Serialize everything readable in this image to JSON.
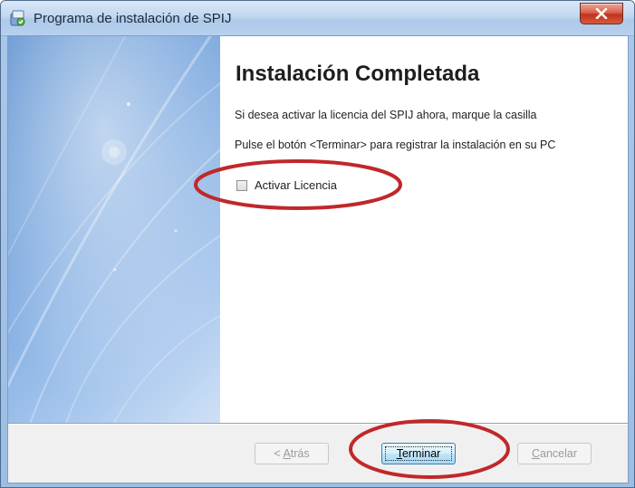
{
  "window": {
    "title": "Programa de instalación de SPIJ",
    "icon": "installer-icon",
    "close_icon": "close-icon"
  },
  "content": {
    "heading": "Instalación Completada",
    "paragraph1": "Si desea activar la licencia del SPIJ ahora, marque la casilla",
    "paragraph2": "Pulse el botón <Terminar> para registrar la instalación en su PC",
    "checkbox": {
      "label": "Activar Licencia",
      "checked": false
    }
  },
  "footer": {
    "back": {
      "prefix": "< ",
      "mnemonic": "A",
      "rest": "trás",
      "enabled": false
    },
    "finish": {
      "mnemonic": "T",
      "rest": "erminar",
      "enabled": true,
      "default": true
    },
    "cancel": {
      "mnemonic": "C",
      "rest": "ancelar",
      "enabled": false
    }
  },
  "colors": {
    "annotation": "#c0282a",
    "panel_blue": "#5a8fd0",
    "close_red": "#c0321c"
  }
}
